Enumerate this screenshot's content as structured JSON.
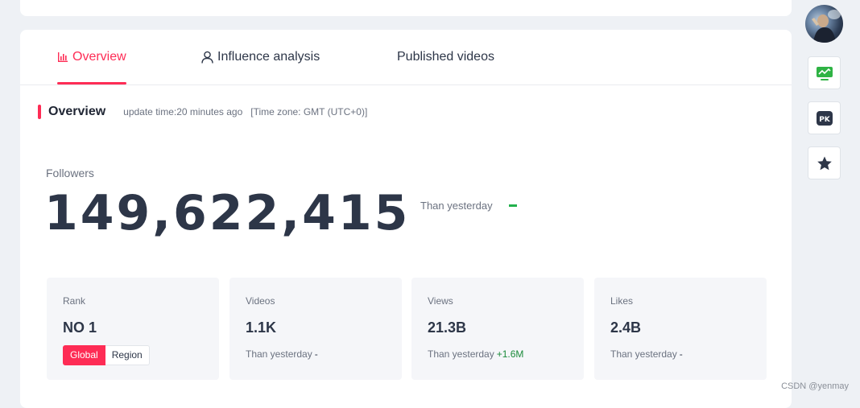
{
  "tabs": [
    {
      "label": "Overview",
      "active": true
    },
    {
      "label": "Influence analysis",
      "active": false
    },
    {
      "label": "Published videos",
      "active": false
    }
  ],
  "section": {
    "title": "Overview",
    "update_time": "update time:20 minutes ago",
    "timezone": "[Time zone: GMT (UTC+0)]"
  },
  "followers": {
    "label": "Followers",
    "value": "149,622,415",
    "than_yesterday": "Than yesterday"
  },
  "stats": {
    "rank": {
      "label": "Rank",
      "value": "NO 1",
      "toggle": [
        "Global",
        "Region"
      ]
    },
    "videos": {
      "label": "Videos",
      "value": "1.1K",
      "sub": "Than yesterday",
      "delta": "-"
    },
    "views": {
      "label": "Views",
      "value": "21.3B",
      "sub": "Than yesterday",
      "delta": "+1.6M"
    },
    "likes": {
      "label": "Likes",
      "value": "2.4B",
      "sub": "Than yesterday",
      "delta": "-"
    }
  },
  "sidebar": {
    "pk_label": "PK"
  },
  "watermark": "CSDN @yenmay",
  "colors": {
    "accent": "#fe2c55",
    "positive": "#1a8a3a",
    "trend_icon": "#2fb344",
    "text_dark": "#2d3648"
  },
  "icons": [
    "bar-chart-icon",
    "user-icon",
    "trend-chart-icon",
    "pk-icon",
    "star-icon"
  ]
}
